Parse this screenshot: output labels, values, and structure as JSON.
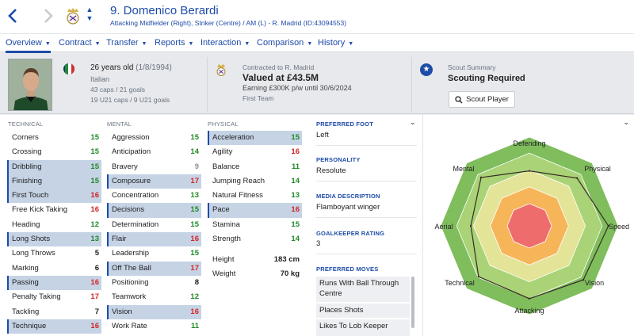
{
  "header": {
    "back_icon": "chevron-left-icon",
    "forward_icon": "chevron-right-icon",
    "player_name": "9. Domenico Berardi",
    "position_line": "Attacking Midfielder (Right), Striker (Centre) / AM (L) - R. Madrid (ID:43094553)"
  },
  "tabs": [
    {
      "label": "Overview",
      "active": true
    },
    {
      "label": "Contract"
    },
    {
      "label": "Transfer"
    },
    {
      "label": "Reports"
    },
    {
      "label": "Interaction"
    },
    {
      "label": "Comparison"
    },
    {
      "label": "History"
    }
  ],
  "summary": {
    "age": "26 years old",
    "dob": "(1/8/1994)",
    "nationality": "Italian",
    "caps": "43 caps / 21 goals",
    "u21_caps": "19 U21 caps / 9 U21 goals",
    "contracted": "Contracted to R. Madrid",
    "valued": "Valued at £43.5M",
    "earning": "Earning £300K p/w until 30/6/2024",
    "squad": "First Team",
    "scout_title": "Scout Summary",
    "scout_status": "Scouting Required",
    "scout_button": "Scout Player"
  },
  "colors": {
    "accent": "#1d4ba8",
    "good": "#1e8b25",
    "bad": "#d32525",
    "highlight": "#c5d3e5"
  },
  "technical": {
    "header": "TECHNICAL",
    "attrs": [
      {
        "name": "Corners",
        "value": "15"
      },
      {
        "name": "Crossing",
        "value": "15"
      },
      {
        "name": "Dribbling",
        "value": "15"
      },
      {
        "name": "Finishing",
        "value": "15"
      },
      {
        "name": "First Touch",
        "value": "16"
      },
      {
        "name": "Free Kick Taking",
        "value": "16"
      },
      {
        "name": "Heading",
        "value": "12"
      },
      {
        "name": "Long Shots",
        "value": "13"
      },
      {
        "name": "Long Throws",
        "value": "5"
      },
      {
        "name": "Marking",
        "value": "6"
      },
      {
        "name": "Passing",
        "value": "16"
      },
      {
        "name": "Penalty Taking",
        "value": "17"
      },
      {
        "name": "Tackling",
        "value": "7"
      },
      {
        "name": "Technique",
        "value": "16"
      }
    ]
  },
  "mental": {
    "header": "MENTAL",
    "attrs": [
      {
        "name": "Aggression",
        "value": "15"
      },
      {
        "name": "Anticipation",
        "value": "14"
      },
      {
        "name": "Bravery",
        "value": "9"
      },
      {
        "name": "Composure",
        "value": "17"
      },
      {
        "name": "Concentration",
        "value": "13"
      },
      {
        "name": "Decisions",
        "value": "15"
      },
      {
        "name": "Determination",
        "value": "15"
      },
      {
        "name": "Flair",
        "value": "16"
      },
      {
        "name": "Leadership",
        "value": "15"
      },
      {
        "name": "Off The Ball",
        "value": "17"
      },
      {
        "name": "Positioning",
        "value": "8"
      },
      {
        "name": "Teamwork",
        "value": "12"
      },
      {
        "name": "Vision",
        "value": "16"
      },
      {
        "name": "Work Rate",
        "value": "11"
      }
    ]
  },
  "physical": {
    "header": "PHYSICAL",
    "attrs": [
      {
        "name": "Acceleration",
        "value": "15"
      },
      {
        "name": "Agility",
        "value": "16"
      },
      {
        "name": "Balance",
        "value": "11"
      },
      {
        "name": "Jumping Reach",
        "value": "14"
      },
      {
        "name": "Natural Fitness",
        "value": "13"
      },
      {
        "name": "Pace",
        "value": "16"
      },
      {
        "name": "Stamina",
        "value": "15"
      },
      {
        "name": "Strength",
        "value": "14"
      }
    ],
    "height_label": "Height",
    "height_value": "183 cm",
    "weight_label": "Weight",
    "weight_value": "70 kg"
  },
  "info": {
    "preferred_foot_label": "PREFERRED FOOT",
    "preferred_foot": "Left",
    "personality_label": "PERSONALITY",
    "personality": "Resolute",
    "media_label": "MEDIA DESCRIPTION",
    "media": "Flamboyant winger",
    "gk_label": "GOALKEEPER RATING",
    "gk": "3",
    "moves_label": "PREFERRED MOVES",
    "moves": [
      "Runs With Ball Through Centre",
      "Places Shots",
      "Likes To Lob Keeper"
    ]
  },
  "radar": {
    "labels": [
      "Defending",
      "Physical",
      "Speed",
      "Vision",
      "Attacking",
      "Technical",
      "Aerial",
      "Mental"
    ],
    "values": [
      0.62,
      0.76,
      0.89,
      0.86,
      0.82,
      0.81,
      0.66,
      0.77
    ]
  }
}
